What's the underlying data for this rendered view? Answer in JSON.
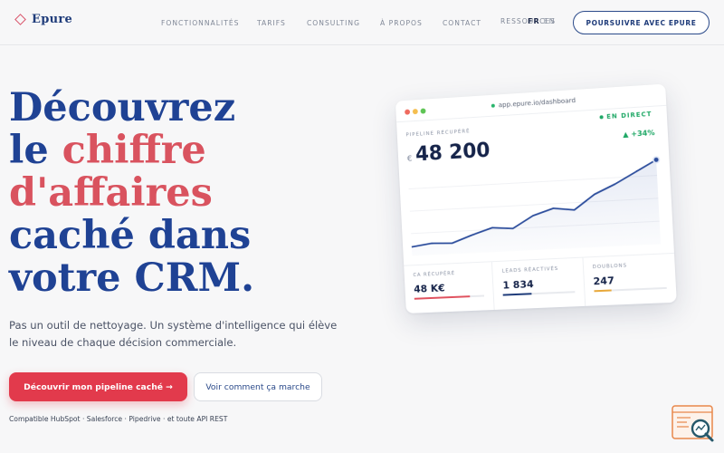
{
  "brand": {
    "name": "Epure"
  },
  "nav": {
    "links": [
      "Fonctionnalités",
      "Tarifs",
      "Consulting",
      "À propos",
      "Contact",
      "Ressources"
    ],
    "lang_active": "FR",
    "lang_other": "EN",
    "cta": "Poursuivre avec Epure"
  },
  "hero": {
    "title_l1": "Découvrez",
    "title_l2a": "le ",
    "title_l2b": "chiffre",
    "title_l3": "d'affaires",
    "title_l4": "caché dans",
    "title_l5": "votre CRM.",
    "subtitle": "Pas un outil de nettoyage. Un système d'intelligence qui élève le niveau de chaque décision commerciale.",
    "primary_cta": "Découvrir mon pipeline caché →",
    "secondary_cta": "Voir comment ça marche",
    "compat": "Compatible HubSpot · Salesforce · Pipedrive · et toute API REST"
  },
  "dashboard": {
    "url": "app.epure.io/dashboard",
    "kpi_label": "Pipeline récupéré",
    "currency": "€",
    "kpi_value": "48 200",
    "live": "EN DIRECT",
    "delta": "▲ +34%",
    "colors": {
      "red": "#e0525f",
      "blue": "#1f3c7a",
      "amber": "#e8a83a",
      "green": "#1fa866"
    },
    "metrics": [
      {
        "label": "CA récupéré",
        "value": "48 K€",
        "fill": 0.8,
        "color": "#e0525f"
      },
      {
        "label": "Leads réactivés",
        "value": "1 834",
        "fill": 0.4,
        "color": "#1f3c7a"
      },
      {
        "label": "Doublons",
        "value": "247",
        "fill": 0.25,
        "color": "#e8a83a"
      }
    ]
  },
  "chart_data": {
    "type": "area",
    "title": "",
    "x": [
      1,
      2,
      3,
      4,
      5,
      6,
      7,
      8,
      9,
      10,
      11,
      12,
      13
    ],
    "series": [
      {
        "values": [
          10,
          13,
          12,
          20,
          27,
          25,
          38,
          45,
          42,
          58,
          68,
          80,
          92
        ]
      }
    ],
    "ylim": [
      0,
      100
    ],
    "grid": true
  }
}
